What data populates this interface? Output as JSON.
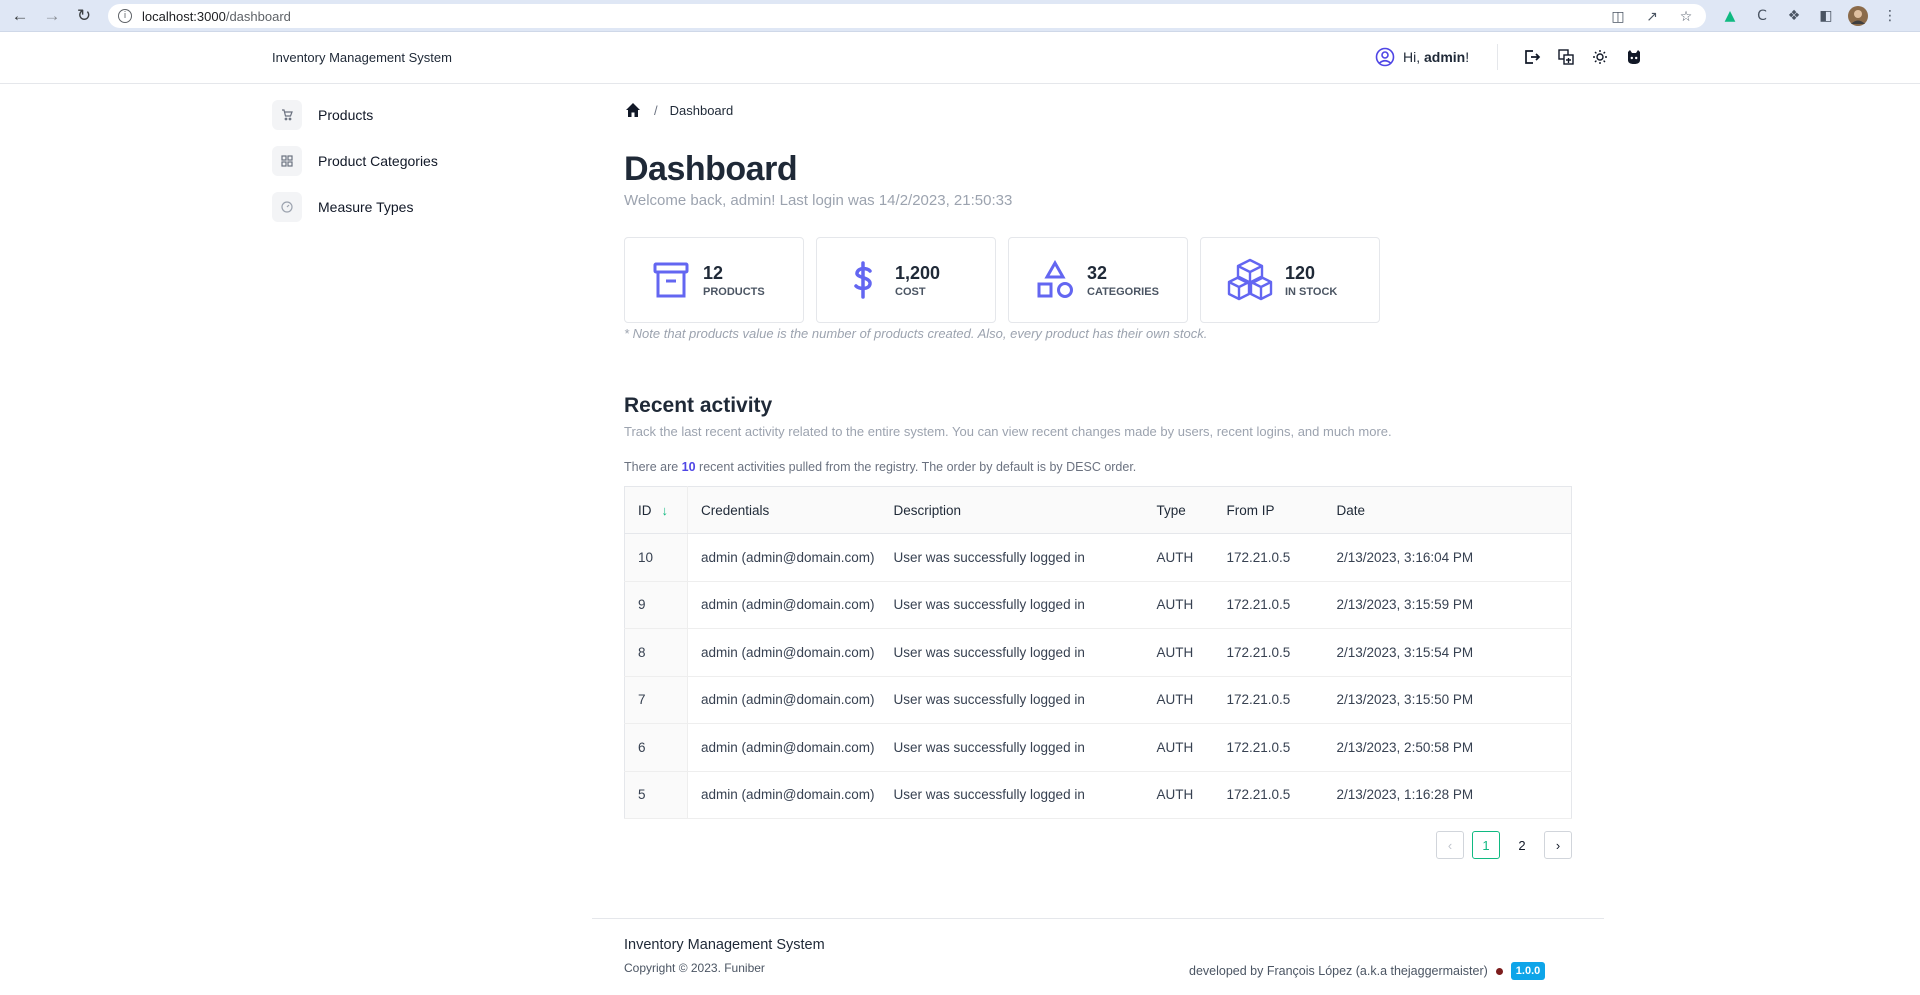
{
  "browser": {
    "url_host": "localhost:3000",
    "url_path": "/dashboard"
  },
  "header": {
    "brand": "Inventory Management System",
    "greeting_prefix": "Hi, ",
    "username": "admin",
    "greeting_suffix": "!"
  },
  "sidebar": {
    "items": [
      {
        "label": "Products",
        "icon": "cart-icon"
      },
      {
        "label": "Product Categories",
        "icon": "grid-icon"
      },
      {
        "label": "Measure Types",
        "icon": "gauge-icon"
      }
    ]
  },
  "breadcrumb": {
    "current": "Dashboard"
  },
  "page": {
    "title": "Dashboard",
    "welcome": "Welcome back, admin! Last login was 14/2/2023, 21:50:33"
  },
  "stats": [
    {
      "value": "12",
      "label": "PRODUCTS",
      "icon": "archive-icon"
    },
    {
      "value": "1,200",
      "label": "COST",
      "icon": "dollar-icon"
    },
    {
      "value": "32",
      "label": "CATEGORIES",
      "icon": "shapes-icon"
    },
    {
      "value": "120",
      "label": "IN STOCK",
      "icon": "cubes-icon"
    }
  ],
  "note": "* Note that products value is the number of products created. Also, every product has their own stock.",
  "activity": {
    "title": "Recent activity",
    "subtitle": "Track the last recent activity related to the entire system. You can view recent changes made by users, recent logins, and much more.",
    "count_prefix": "There are ",
    "count": "10",
    "count_suffix": " recent activities pulled from the registry. The order by default is by DESC order.",
    "columns": [
      "ID",
      "Credentials",
      "Description",
      "Type",
      "From IP",
      "Date"
    ],
    "rows": [
      [
        "10",
        "admin (admin@domain.com)",
        "User was successfully logged in",
        "AUTH",
        "172.21.0.5",
        "2/13/2023, 3:16:04 PM"
      ],
      [
        "9",
        "admin (admin@domain.com)",
        "User was successfully logged in",
        "AUTH",
        "172.21.0.5",
        "2/13/2023, 3:15:59 PM"
      ],
      [
        "8",
        "admin (admin@domain.com)",
        "User was successfully logged in",
        "AUTH",
        "172.21.0.5",
        "2/13/2023, 3:15:54 PM"
      ],
      [
        "7",
        "admin (admin@domain.com)",
        "User was successfully logged in",
        "AUTH",
        "172.21.0.5",
        "2/13/2023, 3:15:50 PM"
      ],
      [
        "6",
        "admin (admin@domain.com)",
        "User was successfully logged in",
        "AUTH",
        "172.21.0.5",
        "2/13/2023, 2:50:58 PM"
      ],
      [
        "5",
        "admin (admin@domain.com)",
        "User was successfully logged in",
        "AUTH",
        "172.21.0.5",
        "2/13/2023, 1:16:28 PM"
      ]
    ]
  },
  "pagination": {
    "pages": [
      "1",
      "2"
    ],
    "current": "1"
  },
  "footer": {
    "title": "Inventory Management System",
    "copyright": "Copyright © 2023. Funiber",
    "developed_by": "developed by François López (a.k.a thejaggermaister)",
    "version": "1.0.0"
  },
  "colors": {
    "accent": "#6366f1",
    "active": "#10b981",
    "badge": "#0ea5e9"
  }
}
